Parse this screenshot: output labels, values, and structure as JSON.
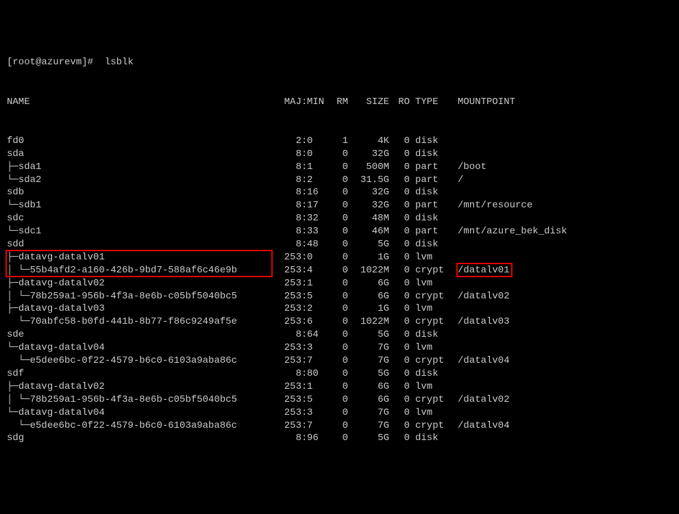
{
  "prompt": "[root@azurevm]#  lsblk",
  "header": {
    "name": "NAME",
    "majmin": "MAJ:MIN",
    "rm": "RM",
    "size": "SIZE",
    "ro": "RO",
    "type": "TYPE",
    "mount": "MOUNTPOINT"
  },
  "rows": [
    {
      "prefix": "",
      "name": "fd0",
      "maj": "2",
      "min": "0",
      "rm": "1",
      "size": "4K",
      "ro": "0",
      "type": "disk",
      "mount": ""
    },
    {
      "prefix": "",
      "name": "sda",
      "maj": "8",
      "min": "0",
      "rm": "0",
      "size": "32G",
      "ro": "0",
      "type": "disk",
      "mount": ""
    },
    {
      "prefix": "├─",
      "name": "sda1",
      "maj": "8",
      "min": "1",
      "rm": "0",
      "size": "500M",
      "ro": "0",
      "type": "part",
      "mount": "/boot"
    },
    {
      "prefix": "└─",
      "name": "sda2",
      "maj": "8",
      "min": "2",
      "rm": "0",
      "size": "31.5G",
      "ro": "0",
      "type": "part",
      "mount": "/"
    },
    {
      "prefix": "",
      "name": "sdb",
      "maj": "8",
      "min": "16",
      "rm": "0",
      "size": "32G",
      "ro": "0",
      "type": "disk",
      "mount": ""
    },
    {
      "prefix": "└─",
      "name": "sdb1",
      "maj": "8",
      "min": "17",
      "rm": "0",
      "size": "32G",
      "ro": "0",
      "type": "part",
      "mount": "/mnt/resource"
    },
    {
      "prefix": "",
      "name": "sdc",
      "maj": "8",
      "min": "32",
      "rm": "0",
      "size": "48M",
      "ro": "0",
      "type": "disk",
      "mount": ""
    },
    {
      "prefix": "└─",
      "name": "sdc1",
      "maj": "8",
      "min": "33",
      "rm": "0",
      "size": "46M",
      "ro": "0",
      "type": "part",
      "mount": "/mnt/azure_bek_disk"
    },
    {
      "prefix": "",
      "name": "sdd",
      "maj": "8",
      "min": "48",
      "rm": "0",
      "size": "5G",
      "ro": "0",
      "type": "disk",
      "mount": ""
    },
    {
      "prefix": "├─",
      "name": "datavg-datalv01",
      "maj": "253",
      "min": "0",
      "rm": "0",
      "size": "1G",
      "ro": "0",
      "type": "lvm",
      "mount": "",
      "hlName": true
    },
    {
      "prefix": "│ └─",
      "name": "55b4afd2-a160-426b-9bd7-588af6c46e9b",
      "maj": "253",
      "min": "4",
      "rm": "0",
      "size": "1022M",
      "ro": "0",
      "type": "crypt",
      "mount": "/datalv01",
      "hlName": true,
      "hlMount": true
    },
    {
      "prefix": "├─",
      "name": "datavg-datalv02",
      "maj": "253",
      "min": "1",
      "rm": "0",
      "size": "6G",
      "ro": "0",
      "type": "lvm",
      "mount": ""
    },
    {
      "prefix": "│ └─",
      "name": "78b259a1-956b-4f3a-8e6b-c05bf5040bc5",
      "maj": "253",
      "min": "5",
      "rm": "0",
      "size": "6G",
      "ro": "0",
      "type": "crypt",
      "mount": "/datalv02"
    },
    {
      "prefix": "├─",
      "name": "datavg-datalv03",
      "maj": "253",
      "min": "2",
      "rm": "0",
      "size": "1G",
      "ro": "0",
      "type": "lvm",
      "mount": ""
    },
    {
      "prefix": "  └─",
      "name": "70abfc58-b0fd-441b-8b77-f86c9249af5e",
      "maj": "253",
      "min": "6",
      "rm": "0",
      "size": "1022M",
      "ro": "0",
      "type": "crypt",
      "mount": "/datalv03"
    },
    {
      "prefix": "",
      "name": "sde",
      "maj": "8",
      "min": "64",
      "rm": "0",
      "size": "5G",
      "ro": "0",
      "type": "disk",
      "mount": ""
    },
    {
      "prefix": "└─",
      "name": "datavg-datalv04",
      "maj": "253",
      "min": "3",
      "rm": "0",
      "size": "7G",
      "ro": "0",
      "type": "lvm",
      "mount": ""
    },
    {
      "prefix": "  └─",
      "name": "e5dee6bc-0f22-4579-b6c0-6103a9aba86c",
      "maj": "253",
      "min": "7",
      "rm": "0",
      "size": "7G",
      "ro": "0",
      "type": "crypt",
      "mount": "/datalv04"
    },
    {
      "prefix": "",
      "name": "sdf",
      "maj": "8",
      "min": "80",
      "rm": "0",
      "size": "5G",
      "ro": "0",
      "type": "disk",
      "mount": ""
    },
    {
      "prefix": "├─",
      "name": "datavg-datalv02",
      "maj": "253",
      "min": "1",
      "rm": "0",
      "size": "6G",
      "ro": "0",
      "type": "lvm",
      "mount": ""
    },
    {
      "prefix": "│ └─",
      "name": "78b259a1-956b-4f3a-8e6b-c05bf5040bc5",
      "maj": "253",
      "min": "5",
      "rm": "0",
      "size": "6G",
      "ro": "0",
      "type": "crypt",
      "mount": "/datalv02"
    },
    {
      "prefix": "└─",
      "name": "datavg-datalv04",
      "maj": "253",
      "min": "3",
      "rm": "0",
      "size": "7G",
      "ro": "0",
      "type": "lvm",
      "mount": ""
    },
    {
      "prefix": "  └─",
      "name": "e5dee6bc-0f22-4579-b6c0-6103a9aba86c",
      "maj": "253",
      "min": "7",
      "rm": "0",
      "size": "7G",
      "ro": "0",
      "type": "crypt",
      "mount": "/datalv04"
    },
    {
      "prefix": "",
      "name": "sdg",
      "maj": "8",
      "min": "96",
      "rm": "0",
      "size": "5G",
      "ro": "0",
      "type": "disk",
      "mount": ""
    }
  ],
  "highlight": {
    "name_box": {
      "startRow": 9,
      "endRow": 10
    },
    "mount_box": {
      "row": 10
    }
  }
}
